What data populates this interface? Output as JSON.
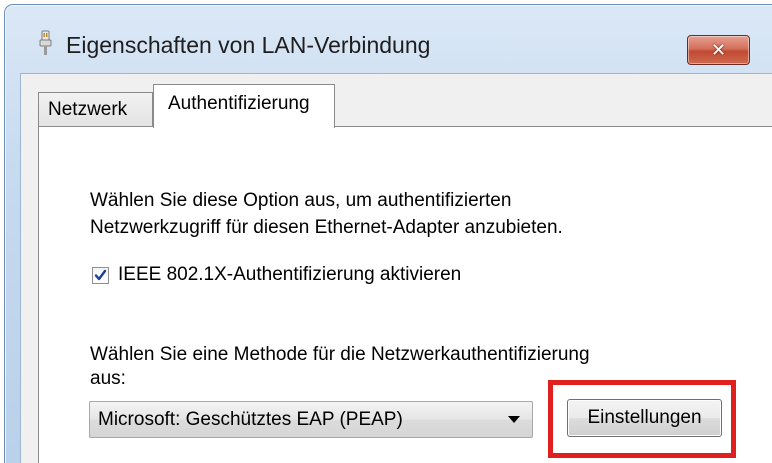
{
  "window": {
    "title": "Eigenschaften von LAN-Verbindung",
    "close_symbol": "✕",
    "title_icon": "network-connection-icon"
  },
  "tabs": [
    {
      "label": "Netzwerk",
      "selected": false
    },
    {
      "label": "Authentifizierung",
      "selected": true
    }
  ],
  "auth": {
    "description_line1": "Wählen Sie diese Option aus, um authentifizierten",
    "description_line2": "Netzwerkzugriff für diesen Ethernet-Adapter anzubieten.",
    "enable_checkbox_label": "IEEE 802.1X-Authentifizierung aktivieren",
    "enable_checked": true,
    "method_prompt_line1": "Wählen Sie eine Methode für die Netzwerkauthentifizierung",
    "method_prompt_line2": "aus:",
    "method_selected": "Microsoft: Geschütztes EAP (PEAP)",
    "settings_button": "Einstellungen"
  },
  "colors": {
    "highlight": "#e0201e",
    "close_button": "#c24a32",
    "checkmark": "#1c3f91"
  }
}
